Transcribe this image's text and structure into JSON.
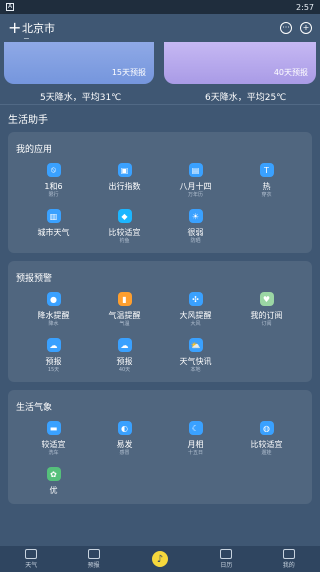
{
  "status": {
    "left_icon": "A",
    "time": "2:57"
  },
  "topbar": {
    "plus": "+",
    "city": "北京市",
    "dash": "−",
    "icons": [
      "chat-icon",
      "add-circle-icon"
    ]
  },
  "forecast": {
    "left": {
      "badge": "15天预报",
      "summary": "5天降水，平均31℃"
    },
    "right": {
      "badge": "40天预报",
      "summary": "6天降水，平均25℃"
    }
  },
  "sections": {
    "life_assistant": "生活助手"
  },
  "apps": {
    "title": "我的应用",
    "items": [
      {
        "label": "1和6",
        "sub": "限行",
        "icon": "no-car-icon"
      },
      {
        "label": "出行指数",
        "sub": "",
        "icon": "bag-icon"
      },
      {
        "label": "八月十四",
        "sub": "万年历",
        "icon": "calendar-icon"
      },
      {
        "label": "热",
        "sub": "穿衣",
        "icon": "shirt-icon"
      },
      {
        "label": "城市天气",
        "sub": "",
        "icon": "city-icon"
      },
      {
        "label": "比较适宜",
        "sub": "钓鱼",
        "icon": "fish-icon"
      },
      {
        "label": "很弱",
        "sub": "防晒",
        "icon": "sun-icon"
      }
    ]
  },
  "alerts": {
    "title": "预报预警",
    "items": [
      {
        "label": "降水提醒",
        "sub": "降水",
        "icon": "drop-icon"
      },
      {
        "label": "气温提醒",
        "sub": "气温",
        "icon": "thermometer-icon"
      },
      {
        "label": "大风提醒",
        "sub": "大风",
        "icon": "wind-icon"
      },
      {
        "label": "我的订阅",
        "sub": "订阅",
        "icon": "bookmark-icon"
      },
      {
        "label": "预报",
        "sub": "15天",
        "icon": "cloud-icon"
      },
      {
        "label": "预报",
        "sub": "40天",
        "icon": "cloud-icon"
      },
      {
        "label": "天气快讯",
        "sub": "本地",
        "icon": "cloud-sun-icon"
      }
    ]
  },
  "life": {
    "title": "生活气象",
    "items": [
      {
        "label": "较适宜",
        "sub": "洗车",
        "icon": "car-icon"
      },
      {
        "label": "易发",
        "sub": "感冒",
        "icon": "pill-icon"
      },
      {
        "label": "月相",
        "sub": "十五日",
        "icon": "moon-icon"
      },
      {
        "label": "比较适宜",
        "sub": "遛娃",
        "icon": "stroller-icon"
      },
      {
        "label": "优",
        "sub": "",
        "icon": "leaf-icon"
      }
    ]
  },
  "nav": [
    {
      "label": "天气",
      "icon": "weather-icon"
    },
    {
      "label": "预报",
      "icon": "forecast-icon"
    },
    {
      "label": "",
      "icon": "speaker-icon"
    },
    {
      "label": "日历",
      "icon": "calendar-icon"
    },
    {
      "label": "我的",
      "icon": "profile-icon"
    }
  ],
  "colors": {
    "bg": "#3f5773",
    "panel": "#50667f",
    "accent": "#3aa1ff",
    "button": "#f6d83d"
  }
}
